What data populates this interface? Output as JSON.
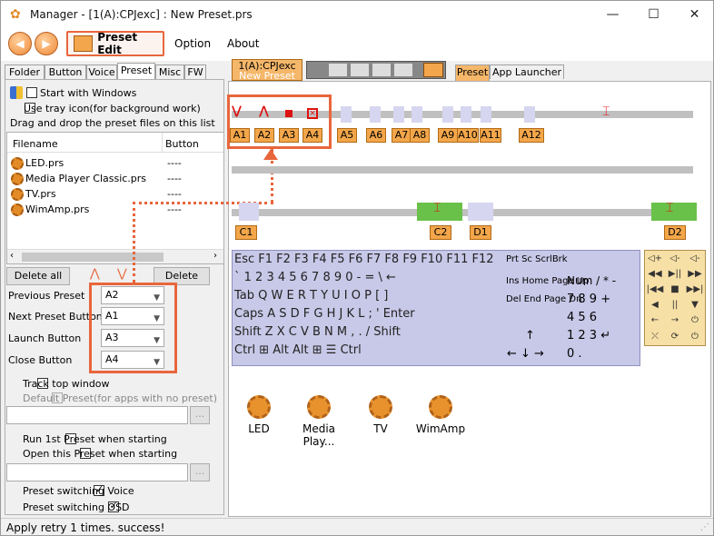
{
  "title": "Manager - [1(A):CPJexc] : New Preset.prs",
  "window_controls": {
    "minimize": "—",
    "maximize": "☐",
    "close": "✕"
  },
  "toolbar": {
    "preset_edit": "Preset Edit"
  },
  "menu": {
    "option": "Option",
    "about": "About"
  },
  "left_tabs": [
    "Folder",
    "Button",
    "Voice",
    "Preset",
    "Misc",
    "FW"
  ],
  "settings": {
    "start_with_windows": "Start with Windows",
    "use_tray_icon": "Use tray icon(for background work)",
    "drag_drop_hint": "Drag and drop the preset files on this list"
  },
  "file_list": {
    "columns": [
      "Filename",
      "Button"
    ],
    "rows": [
      {
        "filename": "LED.prs",
        "button": "----"
      },
      {
        "filename": "Media Player Classic.prs",
        "button": "----"
      },
      {
        "filename": "TV.prs",
        "button": "----"
      },
      {
        "filename": "WimAmp.prs",
        "button": "----"
      }
    ]
  },
  "buttons": {
    "delete_all": "Delete all",
    "delete": "Delete",
    "up": "⋀",
    "down": "⋁"
  },
  "preset_buttons": [
    {
      "label": "Previous Preset",
      "value": "A2"
    },
    {
      "label": "Next Preset Button",
      "value": "A1"
    },
    {
      "label": "Launch Button",
      "value": "A3"
    },
    {
      "label": "Close Button",
      "value": "A4"
    }
  ],
  "options": {
    "track_top_window": "Track top window",
    "default_preset": "Default Preset(for apps with no preset)",
    "run_first": "Run 1st Preset when starting",
    "open_this": "Open this Preset when starting",
    "switching_voice": "Preset switching Voice",
    "switching_osd": "Preset switching OSD",
    "browse": "..."
  },
  "right_tabs": {
    "device": "1(A):CPJexc",
    "device_sub": "New Preset",
    "preset": "Preset",
    "launcher": "App Launcher"
  },
  "button_labels_row1": [
    "A1",
    "A2",
    "A3",
    "A4",
    "A5",
    "A6",
    "A7",
    "A8",
    "A9",
    "A10",
    "A11",
    "A12"
  ],
  "button_labels_row2": [
    "C1",
    "C2",
    "D1",
    "D2"
  ],
  "keyboard": {
    "row1": "Esc   F1 F2 F3 F4  F5 F6 F7 F8   F9 F10 F11 F12",
    "row2": "`   1  2  3  4  5  6  7  8  9  0   -   =  \\  ←",
    "row3": "Tab  Q  W E  R  T  Y  U  I   O  P  [   ]",
    "row4": "Caps A  S  D  F  G  H  J  K  L  ;   '      Enter",
    "row5": "Shift  Z  X  C  V  B  N  M  ,   .   /   Shift",
    "row6": "Ctrl  ⊞ Alt                              Alt  ⊞  ☰  Ctrl",
    "nav1": "Prt Sc  ScrlBrk",
    "nav2": "Ins  Home Page Up",
    "nav3": "Del  End  Page Dn",
    "arrows": "↑",
    "arrows2": "←  ↓  →",
    "numpad1": "Num /    *    -",
    "numpad2": "7  8  9    +",
    "numpad3": "4  5  6",
    "numpad4": "1  2  3   ↵",
    "numpad5": "0       ."
  },
  "media_keys": [
    "◁+",
    "◁-",
    "◁-",
    "◀◀",
    "▶||",
    "▶▶",
    "|◀◀",
    "■",
    "▶▶|",
    "◀",
    "||",
    "▼",
    "←",
    "→",
    "⏻",
    "⤬",
    "⟳",
    "⏻"
  ],
  "preset_items": [
    "LED",
    "Media Play...",
    "TV",
    "WimAmp"
  ],
  "status": "Apply retry  1 times. success!",
  "accent_color": "#e8663c"
}
